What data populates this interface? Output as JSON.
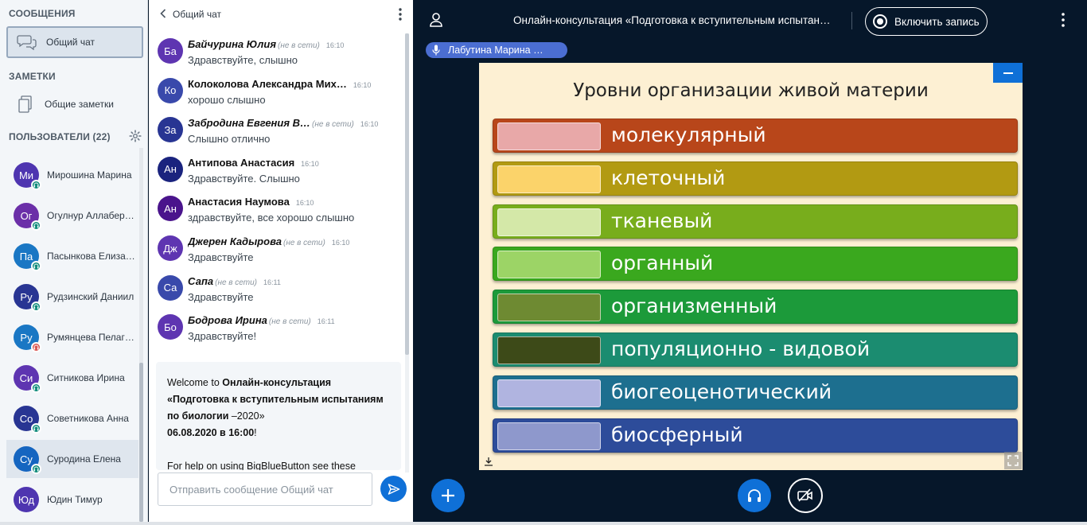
{
  "nav": {
    "messages_heading": "СООБЩЕНИЯ",
    "public_chat_label": "Общий чат",
    "notes_heading": "ЗАМЕТКИ",
    "shared_notes_label": "Общие заметки",
    "users_heading": "ПОЛЬЗОВАТЕЛИ (22)",
    "users": [
      {
        "initials": "Ми",
        "name": "Мирошина Марина",
        "color": "#4e35b0",
        "status": "listen",
        "selected": false
      },
      {
        "initials": "Ог",
        "name": "Огулнур Аллабер…",
        "color": "#6b2fa8",
        "status": "listen",
        "selected": false
      },
      {
        "initials": "Па",
        "name": "Пасынкова Елиза…",
        "color": "#1a77c4",
        "status": "listen",
        "selected": false
      },
      {
        "initials": "Ру",
        "name": "Рудзинский Даниил",
        "color": "#283593",
        "status": "listen",
        "selected": false
      },
      {
        "initials": "Ру",
        "name": "Румянцева Пелаг…",
        "color": "#1a77c4",
        "status": "muted",
        "selected": false
      },
      {
        "initials": "Си",
        "name": "Ситникова Ирина",
        "color": "#5e35b1",
        "status": "listen",
        "selected": false
      },
      {
        "initials": "Со",
        "name": "Советникова Анна",
        "color": "#283593",
        "status": "listen",
        "selected": false
      },
      {
        "initials": "Су",
        "name": "Суродина Елена",
        "color": "#1565c0",
        "status": "listen",
        "selected": true
      },
      {
        "initials": "Юд",
        "name": "Юдин Тимур",
        "color": "#4e35b0",
        "status": "none",
        "selected": false
      }
    ]
  },
  "chat": {
    "title": "Общий чат",
    "messages": [
      {
        "initials": "Ба",
        "color": "#5e35b1",
        "name": "Байчурина Юлия",
        "offline": true,
        "offline_label": "(не в сети)",
        "time": "16:10",
        "text": "Здравствуйте, слышно"
      },
      {
        "initials": "Ко",
        "color": "#3949ab",
        "name": "Колоколова Александра Мих…",
        "offline": false,
        "offline_label": "",
        "time": "16:10",
        "text": "хорошо слышно"
      },
      {
        "initials": "За",
        "color": "#283593",
        "name": "Забродина Евгения В…",
        "offline": true,
        "offline_label": "(не в сети)",
        "time": "16:10",
        "text": "Слышно отлично"
      },
      {
        "initials": "Ан",
        "color": "#1a237e",
        "name": "Антипова Анастасия",
        "offline": false,
        "offline_label": "",
        "time": "16:10",
        "text": "Здравствуйте. Слышно"
      },
      {
        "initials": "Ан",
        "color": "#4a148c",
        "name": "Анастасия Наумова",
        "offline": false,
        "offline_label": "",
        "time": "16:10",
        "text": "здравствуйте, все хорошо слышно"
      },
      {
        "initials": "Дж",
        "color": "#5e35b1",
        "name": "Джерен Кадырова",
        "offline": true,
        "offline_label": "(не в сети)",
        "time": "16:10",
        "text": "Здравствуйте"
      },
      {
        "initials": "Са",
        "color": "#3949ab",
        "name": "Сапа",
        "offline": true,
        "offline_label": "(не в сети)",
        "time": "16:11",
        "text": "Здравствуйте"
      },
      {
        "initials": "Бо",
        "color": "#5e35b1",
        "name": "Бодрова Ирина",
        "offline": true,
        "offline_label": "(не в сети)",
        "time": "16:11",
        "text": "Здравствуйте!"
      }
    ],
    "welcome": {
      "prefix": "Welcome to ",
      "meeting_bold": "Онлайн-консультация «Подготовка к вступительным испытаниям по биологии",
      "year_suffix": " –2020»",
      "date_bold": "06.08.2020 в 16:00",
      "date_suffix": "!",
      "help_text": "For help on using BigBlueButton see these"
    },
    "input_placeholder": "Отправить сообщение Общий чат"
  },
  "main": {
    "meeting_title": "Онлайн-консультация «Подготовка к вступительным испытан…",
    "record_label": "Включить запись",
    "talker_name": "Лабутина Марина …",
    "slide_title": "Уровни организации живой материи",
    "levels": [
      {
        "label": "молекулярный",
        "bar_color": "#b8461a",
        "swatch_color": "#e8a8a8"
      },
      {
        "label": "клеточный",
        "bar_color": "#b29a12",
        "swatch_color": "#fbd36a"
      },
      {
        "label": "тканевый",
        "bar_color": "#78ad1c",
        "swatch_color": "#d4e8a8"
      },
      {
        "label": "органный",
        "bar_color": "#3aa81e",
        "swatch_color": "#9cd466"
      },
      {
        "label": "организменный",
        "bar_color": "#1c9a3a",
        "swatch_color": "#6e8a32"
      },
      {
        "label": "популяционно - видовой",
        "bar_color": "#1b8c70",
        "swatch_color": "#3d4a18"
      },
      {
        "label": "биогеоценотический",
        "bar_color": "#1d6f8f",
        "swatch_color": "#b0b4e0"
      },
      {
        "label": "биосферный",
        "bar_color": "#2d4c9a",
        "swatch_color": "#8e98cc"
      }
    ]
  },
  "colors": {
    "accent": "#0f70d7",
    "listen_badge": "#0d8a7a",
    "muted_badge": "#d9534f",
    "dark_background": "#06172a"
  }
}
